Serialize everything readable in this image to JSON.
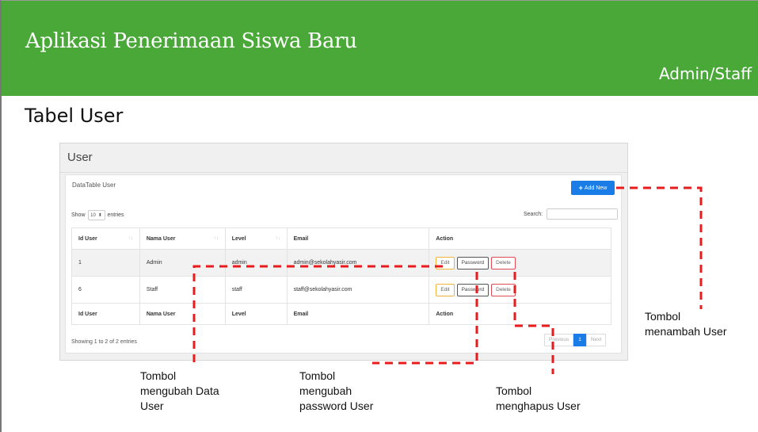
{
  "banner": {
    "title": "Aplikasi Penerimaan Siswa Baru",
    "role": "Admin/Staff",
    "color": "#4aa838"
  },
  "section_title": "Tabel User",
  "app": {
    "header_title": "User",
    "card_title": "DataTable User",
    "add_button": "Add New",
    "show_label": "Show",
    "page_length": "10",
    "entries_label": "entries",
    "search_label": "Search:",
    "columns": [
      "Id User",
      "Nama User",
      "Level",
      "Email",
      "Action"
    ],
    "rows": [
      {
        "id": "1",
        "nama": "Admin",
        "level": "admin",
        "email": "admin@sekolahyasir.com"
      },
      {
        "id": "6",
        "nama": "Staff",
        "level": "staff",
        "email": "staff@sekolahyasir.com"
      }
    ],
    "actions": {
      "edit": "Edit",
      "password": "Password",
      "delete": "Delete"
    },
    "info": "Showing 1 to 2 of 2 entries",
    "pagination": {
      "previous": "Previous",
      "current": "1",
      "next": "Next"
    },
    "accent_color": "#1a7ce6"
  },
  "annotations": {
    "add_user": [
      "Tombol",
      "menambah User"
    ],
    "edit_user": [
      "Tombol",
      "mengubah Data",
      "User"
    ],
    "change_password": [
      "Tombol",
      "mengubah",
      "password User"
    ],
    "delete_user": [
      "Tombol",
      "menghapus User"
    ],
    "line_color": "#e81c1c"
  }
}
